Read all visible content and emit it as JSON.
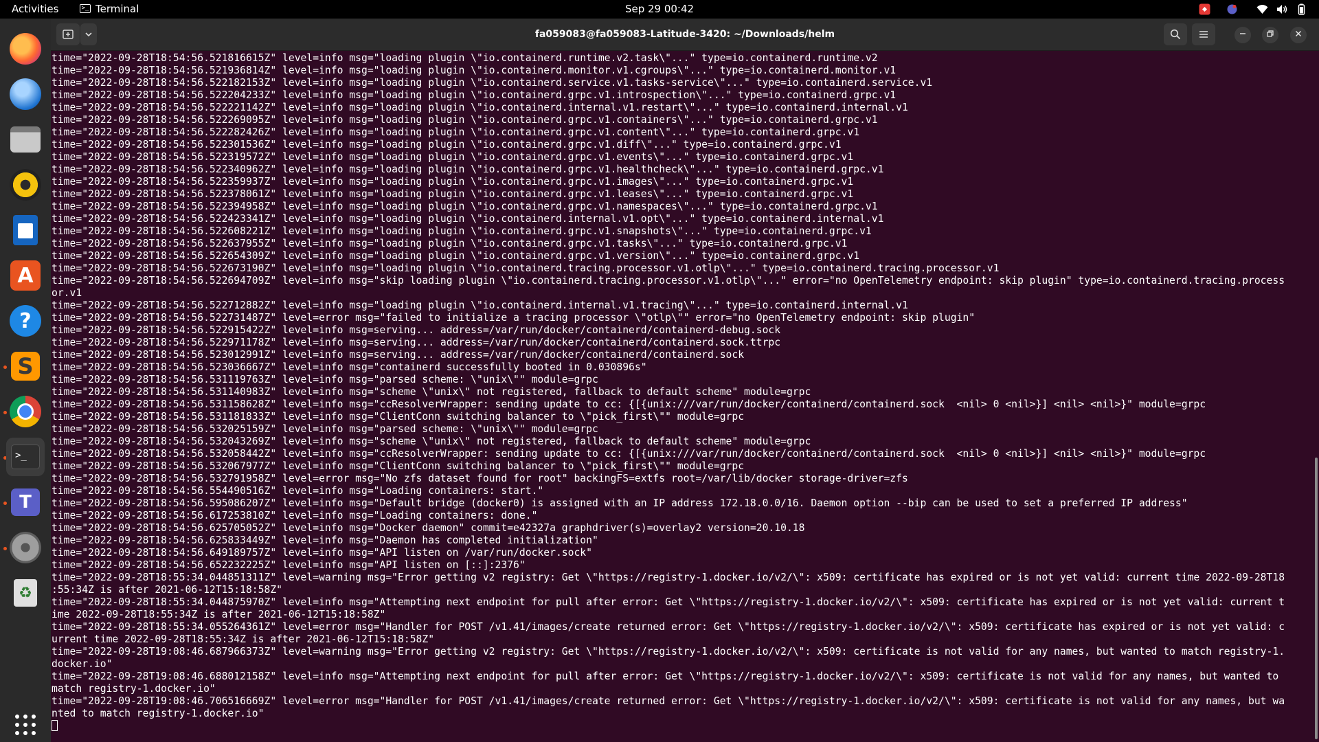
{
  "topbar": {
    "activities": "Activities",
    "app_name": "Terminal",
    "datetime": "Sep 29  00:42"
  },
  "dock": {
    "apps": [
      "firefox-icon",
      "thunderbird-icon",
      "files-icon",
      "rhythmbox-icon",
      "writer-icon",
      "software-icon",
      "help-icon",
      "sublime-text-icon",
      "chrome-icon",
      "terminal-icon",
      "teams-icon",
      "settings-icon",
      "trash-icon"
    ],
    "show_apps": "show-applications-icon"
  },
  "window": {
    "title": "fa059083@fa059083-Latitude-3420: ~/Downloads/helm"
  },
  "terminal": {
    "lines": [
      "time=\"2022-09-28T18:54:56.521816615Z\" level=info msg=\"loading plugin \\\"io.containerd.runtime.v2.task\\\"...\" type=io.containerd.runtime.v2",
      "time=\"2022-09-28T18:54:56.521936814Z\" level=info msg=\"loading plugin \\\"io.containerd.monitor.v1.cgroups\\\"...\" type=io.containerd.monitor.v1",
      "time=\"2022-09-28T18:54:56.522182153Z\" level=info msg=\"loading plugin \\\"io.containerd.service.v1.tasks-service\\\"...\" type=io.containerd.service.v1",
      "time=\"2022-09-28T18:54:56.522204233Z\" level=info msg=\"loading plugin \\\"io.containerd.grpc.v1.introspection\\\"...\" type=io.containerd.grpc.v1",
      "time=\"2022-09-28T18:54:56.522221142Z\" level=info msg=\"loading plugin \\\"io.containerd.internal.v1.restart\\\"...\" type=io.containerd.internal.v1",
      "time=\"2022-09-28T18:54:56.522269095Z\" level=info msg=\"loading plugin \\\"io.containerd.grpc.v1.containers\\\"...\" type=io.containerd.grpc.v1",
      "time=\"2022-09-28T18:54:56.522282426Z\" level=info msg=\"loading plugin \\\"io.containerd.grpc.v1.content\\\"...\" type=io.containerd.grpc.v1",
      "time=\"2022-09-28T18:54:56.522301536Z\" level=info msg=\"loading plugin \\\"io.containerd.grpc.v1.diff\\\"...\" type=io.containerd.grpc.v1",
      "time=\"2022-09-28T18:54:56.522319572Z\" level=info msg=\"loading plugin \\\"io.containerd.grpc.v1.events\\\"...\" type=io.containerd.grpc.v1",
      "time=\"2022-09-28T18:54:56.522340962Z\" level=info msg=\"loading plugin \\\"io.containerd.grpc.v1.healthcheck\\\"...\" type=io.containerd.grpc.v1",
      "time=\"2022-09-28T18:54:56.522359937Z\" level=info msg=\"loading plugin \\\"io.containerd.grpc.v1.images\\\"...\" type=io.containerd.grpc.v1",
      "time=\"2022-09-28T18:54:56.522378061Z\" level=info msg=\"loading plugin \\\"io.containerd.grpc.v1.leases\\\"...\" type=io.containerd.grpc.v1",
      "time=\"2022-09-28T18:54:56.522394958Z\" level=info msg=\"loading plugin \\\"io.containerd.grpc.v1.namespaces\\\"...\" type=io.containerd.grpc.v1",
      "time=\"2022-09-28T18:54:56.522423341Z\" level=info msg=\"loading plugin \\\"io.containerd.internal.v1.opt\\\"...\" type=io.containerd.internal.v1",
      "time=\"2022-09-28T18:54:56.522608221Z\" level=info msg=\"loading plugin \\\"io.containerd.grpc.v1.snapshots\\\"...\" type=io.containerd.grpc.v1",
      "time=\"2022-09-28T18:54:56.522637955Z\" level=info msg=\"loading plugin \\\"io.containerd.grpc.v1.tasks\\\"...\" type=io.containerd.grpc.v1",
      "time=\"2022-09-28T18:54:56.522654309Z\" level=info msg=\"loading plugin \\\"io.containerd.grpc.v1.version\\\"...\" type=io.containerd.grpc.v1",
      "time=\"2022-09-28T18:54:56.522673190Z\" level=info msg=\"loading plugin \\\"io.containerd.tracing.processor.v1.otlp\\\"...\" type=io.containerd.tracing.processor.v1",
      "time=\"2022-09-28T18:54:56.522694709Z\" level=info msg=\"skip loading plugin \\\"io.containerd.tracing.processor.v1.otlp\\\"...\" error=\"no OpenTelemetry endpoint: skip plugin\" type=io.containerd.tracing.process",
      "or.v1",
      "time=\"2022-09-28T18:54:56.522712882Z\" level=info msg=\"loading plugin \\\"io.containerd.internal.v1.tracing\\\"...\" type=io.containerd.internal.v1",
      "time=\"2022-09-28T18:54:56.522731487Z\" level=error msg=\"failed to initialize a tracing processor \\\"otlp\\\"\" error=\"no OpenTelemetry endpoint: skip plugin\"",
      "time=\"2022-09-28T18:54:56.522915422Z\" level=info msg=serving... address=/var/run/docker/containerd/containerd-debug.sock",
      "time=\"2022-09-28T18:54:56.522971178Z\" level=info msg=serving... address=/var/run/docker/containerd/containerd.sock.ttrpc",
      "time=\"2022-09-28T18:54:56.523012991Z\" level=info msg=serving... address=/var/run/docker/containerd/containerd.sock",
      "time=\"2022-09-28T18:54:56.523036667Z\" level=info msg=\"containerd successfully booted in 0.030896s\"",
      "time=\"2022-09-28T18:54:56.531119763Z\" level=info msg=\"parsed scheme: \\\"unix\\\"\" module=grpc",
      "time=\"2022-09-28T18:54:56.531140983Z\" level=info msg=\"scheme \\\"unix\\\" not registered, fallback to default scheme\" module=grpc",
      "time=\"2022-09-28T18:54:56.531158628Z\" level=info msg=\"ccResolverWrapper: sending update to cc: {[{unix:///var/run/docker/containerd/containerd.sock  <nil> 0 <nil>}] <nil> <nil>}\" module=grpc",
      "time=\"2022-09-28T18:54:56.531181833Z\" level=info msg=\"ClientConn switching balancer to \\\"pick_first\\\"\" module=grpc",
      "time=\"2022-09-28T18:54:56.532025159Z\" level=info msg=\"parsed scheme: \\\"unix\\\"\" module=grpc",
      "time=\"2022-09-28T18:54:56.532043269Z\" level=info msg=\"scheme \\\"unix\\\" not registered, fallback to default scheme\" module=grpc",
      "time=\"2022-09-28T18:54:56.532058442Z\" level=info msg=\"ccResolverWrapper: sending update to cc: {[{unix:///var/run/docker/containerd/containerd.sock  <nil> 0 <nil>}] <nil> <nil>}\" module=grpc",
      "time=\"2022-09-28T18:54:56.532067977Z\" level=info msg=\"ClientConn switching balancer to \\\"pick_first\\\"\" module=grpc",
      "time=\"2022-09-28T18:54:56.532791958Z\" level=error msg=\"No zfs dataset found for root\" backingFS=extfs root=/var/lib/docker storage-driver=zfs",
      "time=\"2022-09-28T18:54:56.554490516Z\" level=info msg=\"Loading containers: start.\"",
      "time=\"2022-09-28T18:54:56.595086207Z\" level=info msg=\"Default bridge (docker0) is assigned with an IP address 172.18.0.0/16. Daemon option --bip can be used to set a preferred IP address\"",
      "time=\"2022-09-28T18:54:56.617253810Z\" level=info msg=\"Loading containers: done.\"",
      "time=\"2022-09-28T18:54:56.625705052Z\" level=info msg=\"Docker daemon\" commit=e42327a graphdriver(s)=overlay2 version=20.10.18",
      "time=\"2022-09-28T18:54:56.625833449Z\" level=info msg=\"Daemon has completed initialization\"",
      "time=\"2022-09-28T18:54:56.649189757Z\" level=info msg=\"API listen on /var/run/docker.sock\"",
      "time=\"2022-09-28T18:54:56.652232225Z\" level=info msg=\"API listen on [::]:2376\"",
      "time=\"2022-09-28T18:55:34.044851311Z\" level=warning msg=\"Error getting v2 registry: Get \\\"https://registry-1.docker.io/v2/\\\": x509: certificate has expired or is not yet valid: current time 2022-09-28T18",
      ":55:34Z is after 2021-06-12T15:18:58Z\"",
      "time=\"2022-09-28T18:55:34.044875970Z\" level=info msg=\"Attempting next endpoint for pull after error: Get \\\"https://registry-1.docker.io/v2/\\\": x509: certificate has expired or is not yet valid: current t",
      "ime 2022-09-28T18:55:34Z is after 2021-06-12T15:18:58Z\"",
      "time=\"2022-09-28T18:55:34.055264361Z\" level=error msg=\"Handler for POST /v1.41/images/create returned error: Get \\\"https://registry-1.docker.io/v2/\\\": x509: certificate has expired or is not yet valid: c",
      "urrent time 2022-09-28T18:55:34Z is after 2021-06-12T15:18:58Z\"",
      "time=\"2022-09-28T19:08:46.687966373Z\" level=warning msg=\"Error getting v2 registry: Get \\\"https://registry-1.docker.io/v2/\\\": x509: certificate is not valid for any names, but wanted to match registry-1.",
      "docker.io\"",
      "time=\"2022-09-28T19:08:46.688012158Z\" level=info msg=\"Attempting next endpoint for pull after error: Get \\\"https://registry-1.docker.io/v2/\\\": x509: certificate is not valid for any names, but wanted to",
      "match registry-1.docker.io\"",
      "time=\"2022-09-28T19:08:46.706516669Z\" level=error msg=\"Handler for POST /v1.41/images/create returned error: Get \\\"https://registry-1.docker.io/v2/\\\": x509: certificate is not valid for any names, but wa",
      "nted to match registry-1.docker.io\""
    ]
  },
  "colors": {
    "terminal_bg": "#300a24",
    "accent": "#e95420",
    "headerbar": "#2c2c2c"
  }
}
